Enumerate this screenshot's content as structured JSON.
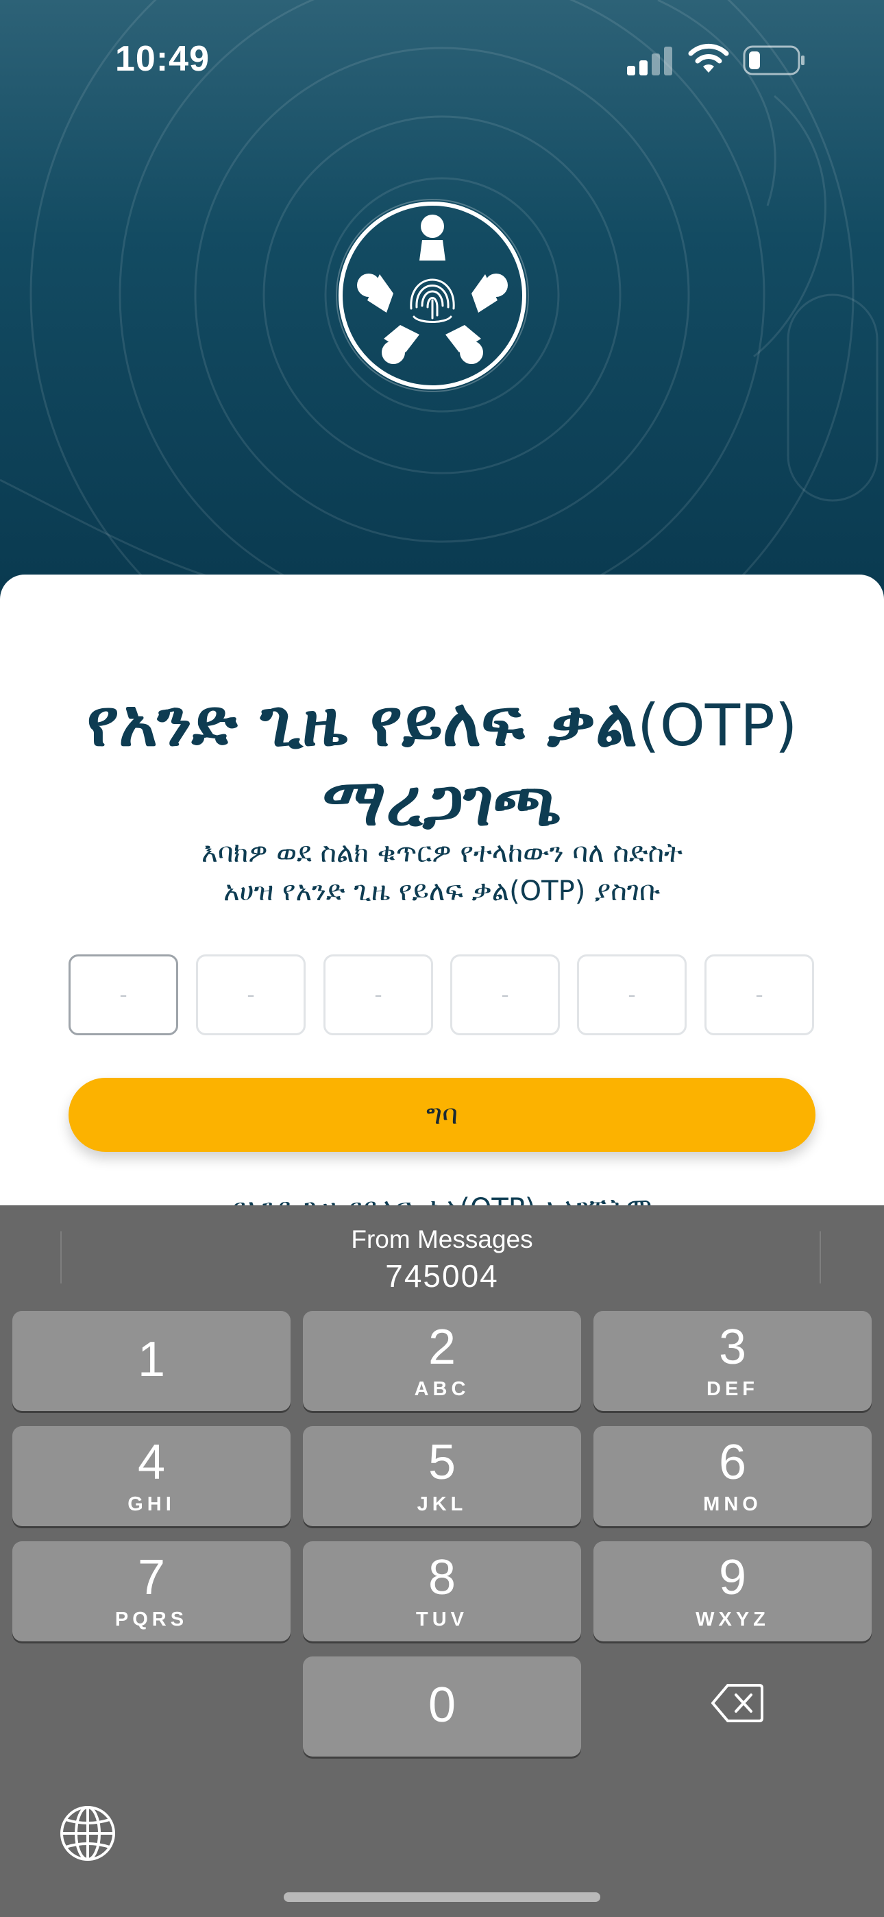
{
  "status_bar": {
    "time": "10:49"
  },
  "screen": {
    "title_main": "የአንድ ጊዜ የይለፍ ቃል",
    "title_suffix": "(OTP)",
    "title_line2": "ማረጋገጫ",
    "subtitle_line1": "እባክዎ ወደ ስልክ ቁጥርዎ  የተላከውን ባለ ስድስት",
    "subtitle_line2": "አሀዝ የአንድ ጊዜ የይለፍ ቃል(OTP) ያስገቡ",
    "otp_placeholder": "-",
    "otp_digits": [
      "-",
      "-",
      "-",
      "-",
      "-",
      "-"
    ],
    "enter_button": "ግባ",
    "resend_text": "የአንድ ጊዜ የይለፍ ቃል(OTP) አላገኙትም"
  },
  "keyboard": {
    "suggestion_label": "From Messages",
    "suggestion_code": "745004",
    "keys": [
      {
        "num": "1",
        "letters": ""
      },
      {
        "num": "2",
        "letters": "ABC"
      },
      {
        "num": "3",
        "letters": "DEF"
      },
      {
        "num": "4",
        "letters": "GHI"
      },
      {
        "num": "5",
        "letters": "JKL"
      },
      {
        "num": "6",
        "letters": "MNO"
      },
      {
        "num": "7",
        "letters": "PQRS"
      },
      {
        "num": "8",
        "letters": "TUV"
      },
      {
        "num": "9",
        "letters": "WXYZ"
      },
      {
        "num": "0",
        "letters": ""
      }
    ],
    "icons": {
      "delete": "delete-backspace-icon",
      "globe": "globe-icon"
    }
  },
  "colors": {
    "header_top": "#2d6277",
    "header_bottom": "#0a3a50",
    "title_color": "#0e3c52",
    "button_color": "#fcb200",
    "keyboard_bg": "#686868",
    "key_bg": "#929292"
  }
}
